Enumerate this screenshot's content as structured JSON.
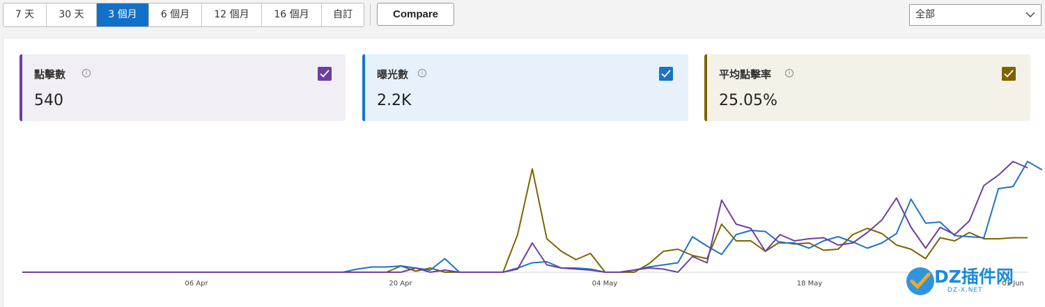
{
  "toolbar": {
    "ranges": [
      "7 天",
      "30 天",
      "3 個月",
      "6 個月",
      "12 個月",
      "16 個月",
      "自訂"
    ],
    "active_range": "3 個月",
    "compare_label": "Compare",
    "filter_value": "全部"
  },
  "metrics": [
    {
      "label": "點擊數",
      "value": "540",
      "checked": true,
      "color": "#6b3fa0"
    },
    {
      "label": "曝光數",
      "value": "2.2K",
      "checked": true,
      "color": "#1a73c7"
    },
    {
      "label": "平均點擊率",
      "value": "25.05%",
      "checked": true,
      "color": "#7d6400"
    }
  ],
  "colors": {
    "clicks": "#6b3fa0",
    "impressions": "#1a73c7",
    "ctr": "#7d6400",
    "active_range_bg": "#1170c8"
  },
  "chart_data": {
    "type": "line",
    "x_ticks": [
      "06 Apr",
      "20 Apr",
      "04 May",
      "18 May",
      "01 Jun"
    ],
    "grid": false,
    "legend": "none",
    "series": [
      {
        "name": "點擊數",
        "values": [
          0,
          0,
          0,
          0,
          0,
          0,
          0,
          0,
          0,
          0,
          0,
          0,
          0,
          0,
          0,
          0,
          0,
          0,
          0,
          0,
          0,
          0,
          0,
          0,
          0,
          0,
          0,
          0.04,
          0,
          0.02,
          0,
          0,
          0,
          0,
          0.03,
          0.28,
          0.07,
          0.04,
          0.03,
          0.02,
          0,
          0,
          0.02,
          0.04,
          0.03,
          0,
          0.15,
          0.09,
          0.69,
          0.46,
          0.42,
          0.2,
          0.36,
          0.3,
          0.32,
          0.33,
          0.26,
          0.28,
          0.38,
          0.5,
          0.71,
          0.43,
          0.23,
          0.43,
          0.36,
          0.49,
          0.83,
          0.93,
          1.06,
          1.0
        ]
      },
      {
        "name": "曝光數",
        "values": [
          0,
          0,
          0,
          0,
          0,
          0,
          0,
          0,
          0,
          0,
          0,
          0,
          0,
          0,
          0,
          0,
          0,
          0,
          0,
          0,
          0,
          0,
          0,
          0.03,
          0.05,
          0.05,
          0.06,
          0.04,
          0.02,
          0.13,
          0,
          0,
          0,
          0,
          0.04,
          0.09,
          0.1,
          0.04,
          0.04,
          0.03,
          0,
          0,
          0.02,
          0.05,
          0.07,
          0.09,
          0.34,
          0.25,
          0.17,
          0.36,
          0.4,
          0.39,
          0.28,
          0.28,
          0.23,
          0.3,
          0.34,
          0.29,
          0.23,
          0.28,
          0.37,
          0.7,
          0.47,
          0.48,
          0.35,
          0.34,
          0.33,
          0.8,
          0.82,
          1.06,
          0.98
        ]
      },
      {
        "name": "平均點擊率",
        "values": [
          0,
          0,
          0,
          0,
          0,
          0,
          0,
          0,
          0,
          0,
          0,
          0,
          0,
          0,
          0,
          0,
          0,
          0,
          0,
          0,
          0,
          0,
          0,
          0,
          0,
          0,
          0.06,
          0.01,
          0.04,
          0,
          0,
          0,
          0,
          0,
          0.36,
          0.99,
          0.32,
          0.2,
          0.12,
          0.18,
          0,
          0,
          0,
          0.08,
          0.2,
          0.22,
          0.16,
          0.13,
          0.46,
          0.3,
          0.3,
          0.2,
          0.29,
          0.27,
          0.28,
          0.21,
          0.22,
          0.36,
          0.42,
          0.37,
          0.26,
          0.22,
          0.13,
          0.33,
          0.3,
          0.38,
          0.32,
          0.32,
          0.33,
          0.33
        ]
      }
    ]
  },
  "watermark": {
    "text": "DZ插件网",
    "sub": "DZ-X.NET"
  }
}
